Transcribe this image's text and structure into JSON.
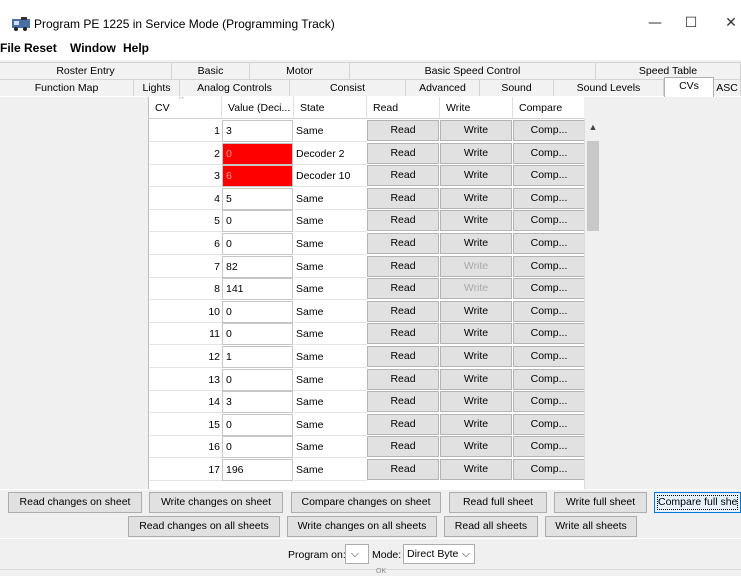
{
  "window": {
    "title": "Program PE 1225 in Service Mode (Programming Track)",
    "minimize_glyph": "—",
    "maximize_glyph": "☐",
    "close_glyph": "✕",
    "icon": "locomotive-icon"
  },
  "menu": [
    "File",
    "Reset",
    "Window",
    "Help"
  ],
  "tabs": {
    "row1": [
      "Roster Entry",
      "Basic",
      "Motor",
      "Basic Speed Control",
      "Speed Table"
    ],
    "row2": [
      "Function Map",
      "Lights",
      "Analog Controls",
      "Consist",
      "Advanced",
      "Sound",
      "Sound Levels",
      "CVs",
      "ASC"
    ],
    "active": "CVs"
  },
  "table": {
    "headers": {
      "cv": "CV",
      "value": "Value (Deci...",
      "state": "State",
      "read": "Read",
      "write": "Write",
      "compare": "Compare"
    },
    "sort_glyph": "^",
    "rows": [
      {
        "cv": "1",
        "value": "3",
        "state": "Same",
        "read": "Read",
        "write": "Write",
        "compare": "Comp..."
      },
      {
        "cv": "2",
        "value": "0",
        "state": "Decoder 2",
        "read": "Read",
        "write": "Write",
        "compare": "Comp..."
      },
      {
        "cv": "3",
        "value": "6",
        "state": "Decoder 10",
        "read": "Read",
        "write": "Write",
        "compare": "Comp..."
      },
      {
        "cv": "4",
        "value": "5",
        "state": "Same",
        "read": "Read",
        "write": "Write",
        "compare": "Comp..."
      },
      {
        "cv": "5",
        "value": "0",
        "state": "Same",
        "read": "Read",
        "write": "Write",
        "compare": "Comp..."
      },
      {
        "cv": "6",
        "value": "0",
        "state": "Same",
        "read": "Read",
        "write": "Write",
        "compare": "Comp..."
      },
      {
        "cv": "7",
        "value": "82",
        "state": "Same",
        "read": "Read",
        "write": "Write",
        "compare": "Comp..."
      },
      {
        "cv": "8",
        "value": "141",
        "state": "Same",
        "read": "Read",
        "write": "Write",
        "compare": "Comp..."
      },
      {
        "cv": "10",
        "value": "0",
        "state": "Same",
        "read": "Read",
        "write": "Write",
        "compare": "Comp..."
      },
      {
        "cv": "11",
        "value": "0",
        "state": "Same",
        "read": "Read",
        "write": "Write",
        "compare": "Comp..."
      },
      {
        "cv": "12",
        "value": "1",
        "state": "Same",
        "read": "Read",
        "write": "Write",
        "compare": "Comp..."
      },
      {
        "cv": "13",
        "value": "0",
        "state": "Same",
        "read": "Read",
        "write": "Write",
        "compare": "Comp..."
      },
      {
        "cv": "14",
        "value": "3",
        "state": "Same",
        "read": "Read",
        "write": "Write",
        "compare": "Comp..."
      },
      {
        "cv": "15",
        "value": "0",
        "state": "Same",
        "read": "Read",
        "write": "Write",
        "compare": "Comp..."
      },
      {
        "cv": "16",
        "value": "0",
        "state": "Same",
        "read": "Read",
        "write": "Write",
        "compare": "Comp..."
      },
      {
        "cv": "17",
        "value": "196",
        "state": "Same",
        "read": "Read",
        "write": "Write",
        "compare": "Comp..."
      }
    ],
    "highlight_color": "#ff0000"
  },
  "sheet_buttons": [
    "Read changes on sheet",
    "Write changes on sheet",
    "Compare changes on sheet",
    "Read full sheet",
    "Write full sheet",
    "Compare full she"
  ],
  "all_sheets_buttons": [
    "Read changes on all sheets",
    "Write changes on all sheets",
    "Read all sheets",
    "Write all sheets"
  ],
  "program": {
    "program_on_label": "Program on:",
    "program_on_value": "",
    "mode_label": "Mode:",
    "mode_value": "Direct Byte",
    "dropdown_glyph": "⌵"
  },
  "status": {
    "text": "OK"
  }
}
